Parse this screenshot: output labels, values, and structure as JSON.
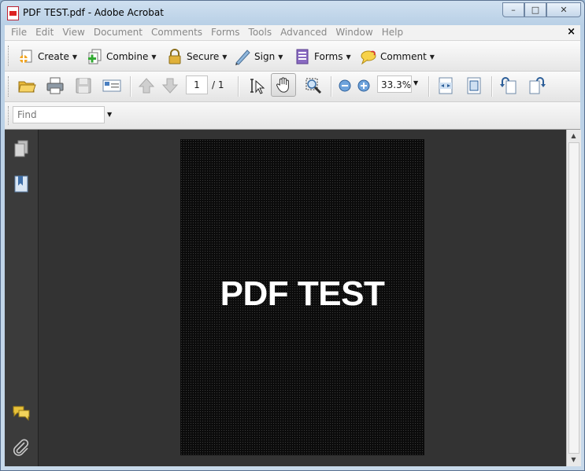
{
  "window": {
    "title": "PDF TEST.pdf - Adobe Acrobat"
  },
  "menu": [
    "File",
    "Edit",
    "View",
    "Document",
    "Comments",
    "Forms",
    "Tools",
    "Advanced",
    "Window",
    "Help"
  ],
  "menu_close": "×",
  "tasks": {
    "create": "Create",
    "combine": "Combine",
    "secure": "Secure",
    "sign": "Sign",
    "forms": "Forms",
    "comment": "Comment"
  },
  "nav": {
    "page_current": "1",
    "page_total": "/ 1"
  },
  "zoom": {
    "value": "33.3%"
  },
  "find": {
    "placeholder": "Find"
  },
  "document": {
    "text": "PDF TEST"
  },
  "icons": [
    "open-icon",
    "print-icon",
    "save-icon",
    "email-icon",
    "prev-page-icon",
    "next-page-icon",
    "select-tool-icon",
    "hand-tool-icon",
    "zoom-tool-icon",
    "zoom-out-icon",
    "zoom-in-icon",
    "fit-width-icon",
    "fit-page-icon",
    "rotate-ccw-icon",
    "rotate-cw-icon",
    "pages-icon",
    "bookmarks-icon",
    "comments-icon",
    "attachments-icon"
  ]
}
